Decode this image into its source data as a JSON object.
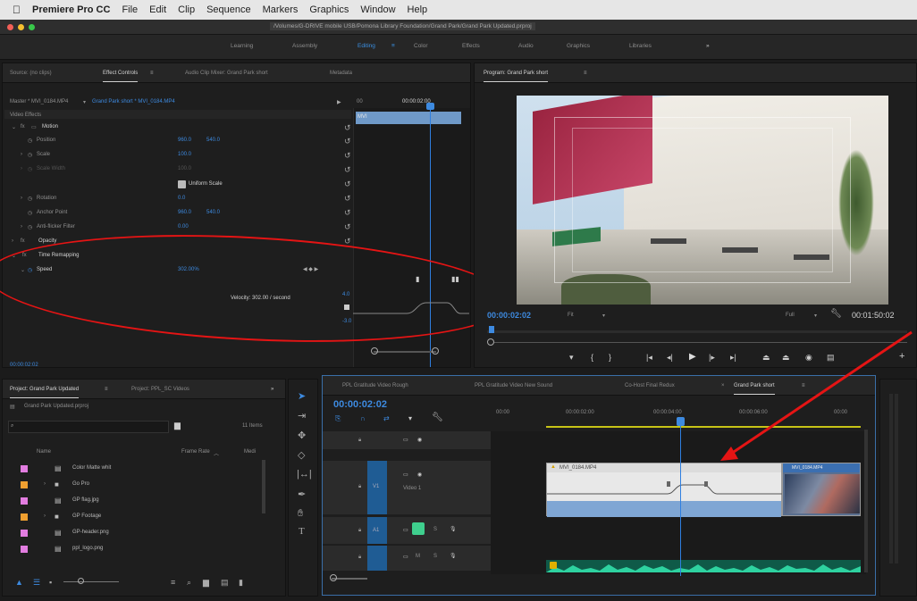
{
  "menubar": {
    "apple": "",
    "app": "Premiere Pro CC",
    "items": [
      "File",
      "Edit",
      "Clip",
      "Sequence",
      "Markers",
      "Graphics",
      "Window",
      "Help"
    ]
  },
  "titlebar": {
    "path": "/Volumes/G-DRIVE mobile USB/Pomona Library Foundation/Grand Park/Grand Park Updated.prproj"
  },
  "workspaces": {
    "items": [
      "Learning",
      "Assembly",
      "Editing",
      "Color",
      "Effects",
      "Audio",
      "Graphics",
      "Libraries"
    ],
    "active": "Editing",
    "more": "»"
  },
  "source_panel": {
    "tabs": [
      "Source: (no clips)",
      "Effect Controls",
      "Audio Clip Mixer: Grand Park short",
      "Metadata"
    ],
    "master": "Master * MVI_0184.MP4",
    "sequence_clip": "Grand Park short * MVI_0184.MP4",
    "mini_time_in": "00",
    "mini_time_out": "00:00:02:00",
    "clip_label": "MVI",
    "section": "Video Effects",
    "motion": "Motion",
    "position_label": "Position",
    "position_x": "960.0",
    "position_y": "540.0",
    "scale_label": "Scale",
    "scale_value": "100.0",
    "scale_width_label": "Scale Width",
    "scale_width_value": "100.0",
    "uniform_scale": "Uniform Scale",
    "rotation_label": "Rotation",
    "rotation_value": "0.0",
    "anchor_label": "Anchor Point",
    "anchor_x": "960.0",
    "anchor_y": "540.0",
    "flicker_label": "Anti-flicker Filter",
    "flicker_value": "0.00",
    "opacity_label": "Opacity",
    "remap_label": "Time Remapping",
    "speed_label": "Speed",
    "speed_value": "302.00%",
    "velocity": "Velocity: 302.00 / second",
    "graph_top": "4.0",
    "graph_bottom": "-3.0",
    "timecode": "00:00:02:02"
  },
  "program_panel": {
    "tab": "Program: Grand Park short",
    "timecode": "00:00:02:02",
    "fit": "Fit",
    "quality": "Full",
    "duration": "00:01:50:02"
  },
  "project_panel": {
    "tabs": [
      "Project: Grand Park Updated",
      "Project: PPL_SC Videos",
      "»"
    ],
    "file": "Grand Park Updated.prproj",
    "search_placeholder": "",
    "item_count": "11 Items",
    "col_name": "Name",
    "col_frame_rate": "Frame Rate",
    "col_media": "Medi",
    "items": [
      {
        "name": "Color Matte whit",
        "color": "#e27de0",
        "type": "file",
        "expand": ""
      },
      {
        "name": "Go Pro",
        "color": "#f0a030",
        "type": "folder",
        "expand": "›"
      },
      {
        "name": "GP flag.jpg",
        "color": "#e27de0",
        "type": "file",
        "expand": ""
      },
      {
        "name": "GP Footage",
        "color": "#f0a030",
        "type": "folder",
        "expand": "›"
      },
      {
        "name": "GP-header.png",
        "color": "#e27de0",
        "type": "file",
        "expand": ""
      },
      {
        "name": "ppl_logo.png",
        "color": "#e27de0",
        "type": "file",
        "expand": ""
      }
    ]
  },
  "timeline_panel": {
    "tabs": [
      "PPL Gratitude Video Rough",
      "PPL Gratitude Video New Sound",
      "Co-Host Final Redux",
      "Grand Park short"
    ],
    "active_tab": "Grand Park short",
    "timecode": "00:00:02:02",
    "ruler": [
      "00:00",
      "00:00:02:00",
      "00:00:04:00",
      "00:00:06:00",
      "00:00"
    ],
    "video1_label": "Video 1",
    "v1": "V1",
    "a1": "A1",
    "clip_name": "MVI_0184.MP4",
    "clip2_name": "MVI_0184.MP4"
  },
  "colors": {
    "accent": "#3d8ae0",
    "annotation": "#e51414",
    "clip": "#5e86b4",
    "audio": "#1e9c7d"
  }
}
